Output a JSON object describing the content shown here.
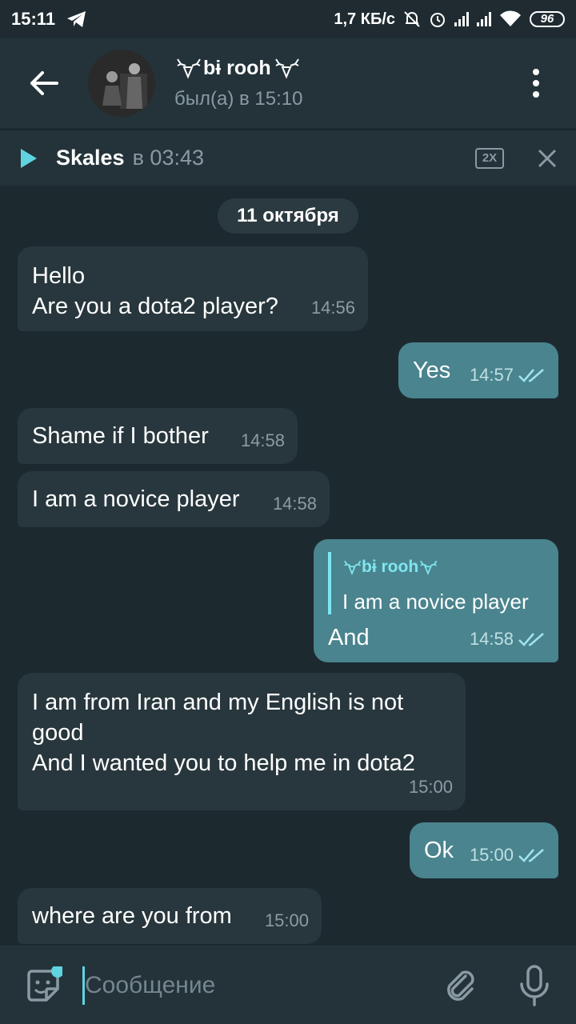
{
  "status_bar": {
    "time": "15:11",
    "net_speed": "1,7 КБ/с",
    "battery": "96"
  },
  "header": {
    "chat_name": "bɨ rooh",
    "last_seen": "был(а) в 15:10"
  },
  "player": {
    "title": "Skales",
    "time": "в 03:43",
    "speed": "2X"
  },
  "date_chip": "11 октября",
  "messages": [
    {
      "dir": "in",
      "text": "Hello\nAre you a dota2 player?",
      "time": "14:56"
    },
    {
      "dir": "out",
      "text": "Yes",
      "time": "14:57"
    },
    {
      "dir": "in",
      "text": "Shame if I bother",
      "time": "14:58"
    },
    {
      "dir": "in",
      "text": "I am a novice player",
      "time": "14:58"
    },
    {
      "dir": "out",
      "reply_name": "bɨ rooh",
      "reply_text": "I am a novice player",
      "text": "And",
      "time": "14:58"
    },
    {
      "dir": "in",
      "text": "I am from Iran and my English is not\ngood\nAnd I wanted you to help me in dota2",
      "time": "15:00"
    },
    {
      "dir": "out",
      "text": "Ok",
      "time": "15:00"
    },
    {
      "dir": "in",
      "text": "where are you from",
      "time": "15:00"
    }
  ],
  "input": {
    "placeholder": "Сообщение"
  },
  "colors": {
    "background": "#1c2a30",
    "header": "#24333a",
    "incoming_bubble": "#28373d",
    "outgoing_bubble": "#4a848e",
    "accent": "#5fd3e0"
  }
}
